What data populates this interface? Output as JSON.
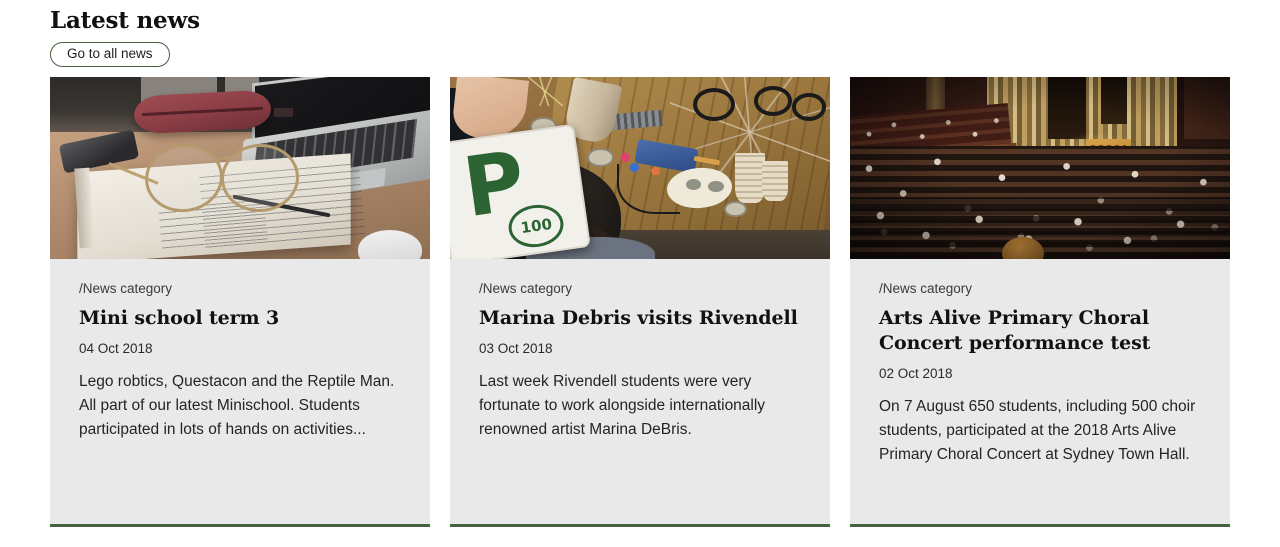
{
  "section": {
    "title": "Latest news",
    "cta_label": "Go to all news"
  },
  "theme": {
    "accent_green": "#456140",
    "card_background": "#e9e9e9",
    "page_background": "#ffffff",
    "text_color": "#1a1a1a"
  },
  "cards": [
    {
      "category": "/News category",
      "title": "Mini school term 3",
      "date": "04 Oct 2018",
      "excerpt": "Lego robtics, Questacon and the Reptile Man. All part of our latest Minischool. Students participated in lots of hands on activities...",
      "image_alt": "Desk with laptop, red pencil case, reading glasses on an open notebook and a smartphone"
    },
    {
      "category": "/News category",
      "title": "Marina Debris visits Rivendell",
      "date": "03 Oct 2018",
      "excerpt": "Last week Rivendell students were very fortunate to work alongside internationally renowned artist Marina DeBris.",
      "image_alt": "Student at a craft table with a green P-plate sign, glue gun and recycled materials",
      "sign_letter": "P",
      "sign_number": "100"
    },
    {
      "category": "/News category",
      "title": "Arts Alive Primary Choral Concert performance test",
      "date": "02 Oct 2018",
      "excerpt": "On 7 August 650 students, including 500 choir students, participated at the 2018 Arts Alive Primary Choral Concert at Sydney Town Hall.",
      "image_alt": "Large choir performing in a concert hall with organ pipes"
    }
  ]
}
